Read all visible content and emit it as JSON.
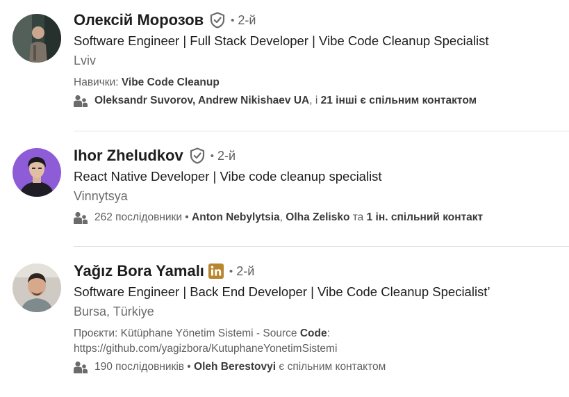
{
  "results": [
    {
      "name": "Олексій Морозов",
      "degree": "2-й",
      "headline": "Software Engineer | Full Stack Developer | Vibe Code Cleanup Specialist",
      "location": "Lviv",
      "skills_prefix": "Навички: ",
      "skills_value": "Vibe Code Cleanup",
      "mutual": {
        "names": "Oleksandr Suvorov, Andrew Nikishaev UA",
        "sep": ", і ",
        "others": "21 інші",
        "suffix": " є спільним контактом"
      },
      "badge_icon": "verified-shield-icon",
      "avatar_bg": "#3a4a44"
    },
    {
      "name": "Ihor Zheludkov",
      "degree": "2-й",
      "headline": "React Native Developer | Vibe code cleanup specialist",
      "location": "Vinnytsya",
      "followers": "262 послідовники",
      "bullet": " • ",
      "mutual": {
        "name1": "Anton Nebylytsia",
        "sep1": ", ",
        "name2": "Olha Zelisko",
        "sep2": " та ",
        "others": "1 ін. спільний контакт"
      },
      "badge_icon": "verified-shield-icon",
      "avatar_bg": "#8d5cd6"
    },
    {
      "name": "Yağız Bora Yamalı",
      "degree": "2-й",
      "headline": "Software Engineer | Back End Developer | Vibe Code Cleanup Specialist’",
      "location": "Bursa, Türkiye",
      "project_prefix": "Проєкти: Kütüphane Yönetim Sistemi - Source ",
      "project_bold": "Code",
      "project_suffix": ":",
      "project_url": "https://github.com/yagizbora/KutuphaneYonetimSistemi",
      "followers": "190 послідовників",
      "bullet": " • ",
      "mutual": {
        "name": "Oleh Berestovyi",
        "suffix": " є спільним контактом"
      },
      "badge_icon": "linkedin-premium-icon",
      "avatar_bg": "#c9c4bd"
    }
  ],
  "dot": "•",
  "colors": {
    "text": "#1d1d1d",
    "secondary": "#6b6b6b",
    "badge_gray": "#6b6b6b",
    "premium_gold": "#b8862e",
    "divider": "#e2e2e2"
  }
}
